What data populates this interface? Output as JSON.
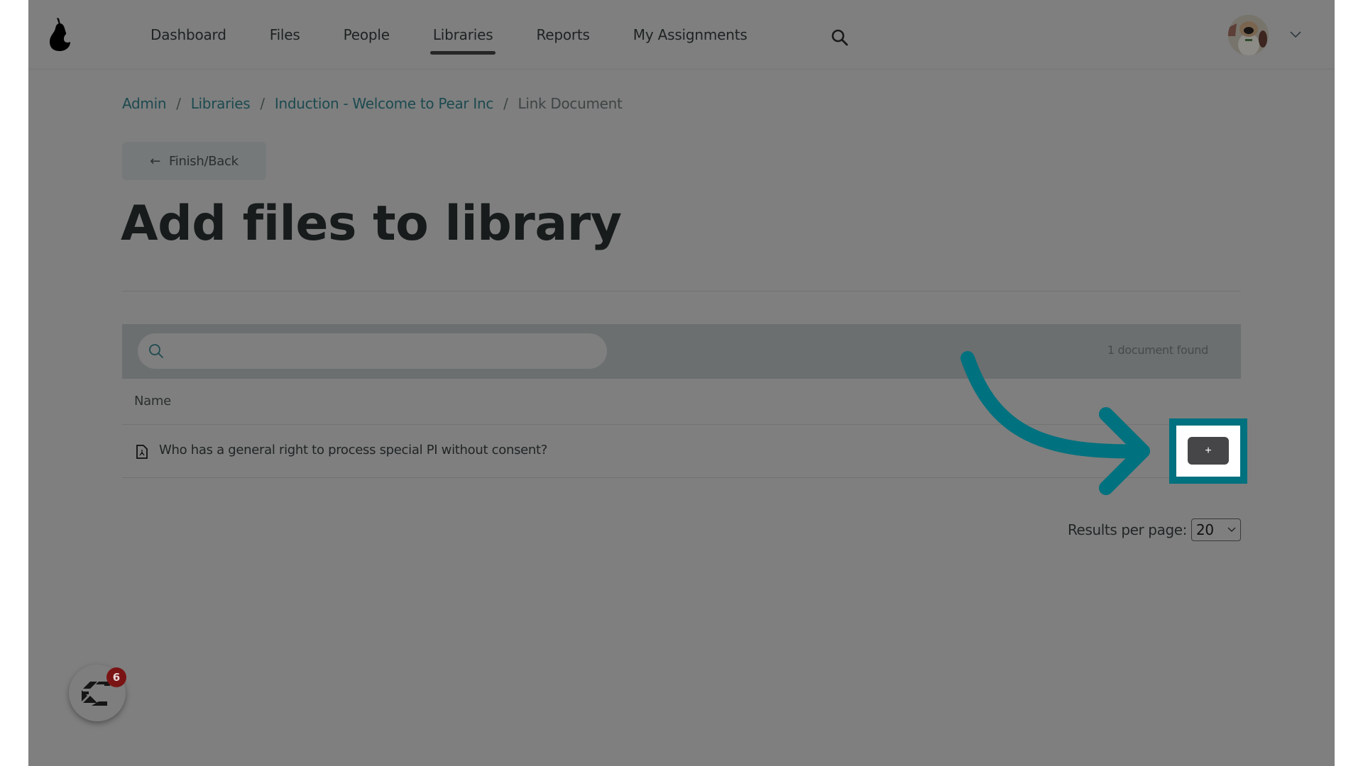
{
  "header": {
    "logo_icon": "pear-logo-icon",
    "nav": [
      {
        "label": "Dashboard",
        "active": false
      },
      {
        "label": "Files",
        "active": false
      },
      {
        "label": "People",
        "active": false
      },
      {
        "label": "Libraries",
        "active": true
      },
      {
        "label": "Reports",
        "active": false
      },
      {
        "label": "My Assignments",
        "active": false
      }
    ],
    "search_icon": "search-icon",
    "avatar_icon": "user-avatar",
    "menu_icon": "chevron-down-icon"
  },
  "breadcrumb": {
    "items": [
      {
        "label": "Admin",
        "link": true
      },
      {
        "label": "Libraries",
        "link": true
      },
      {
        "label": "Induction - Welcome to Pear Inc",
        "link": true
      },
      {
        "label": "Link Document",
        "link": false
      }
    ],
    "separator": "/"
  },
  "back_button": {
    "label": "Finish/Back",
    "icon": "←"
  },
  "page_title": "Add files to library",
  "search": {
    "placeholder": "",
    "value": "",
    "count_text": "1 document found"
  },
  "table": {
    "columns": [
      "Name"
    ],
    "rows": [
      {
        "name": "Who has a general right to process special PI without consent?",
        "icon": "pdf-file-icon",
        "action_label": "+"
      }
    ]
  },
  "pagination": {
    "label": "Results per page:",
    "selected": "20"
  },
  "widget": {
    "badge_count": "6",
    "icon": "chat-widget-icon"
  },
  "colors": {
    "annotation": "#00717e",
    "overlay_bg": "#7f7f7f",
    "badge": "#7a1414"
  }
}
